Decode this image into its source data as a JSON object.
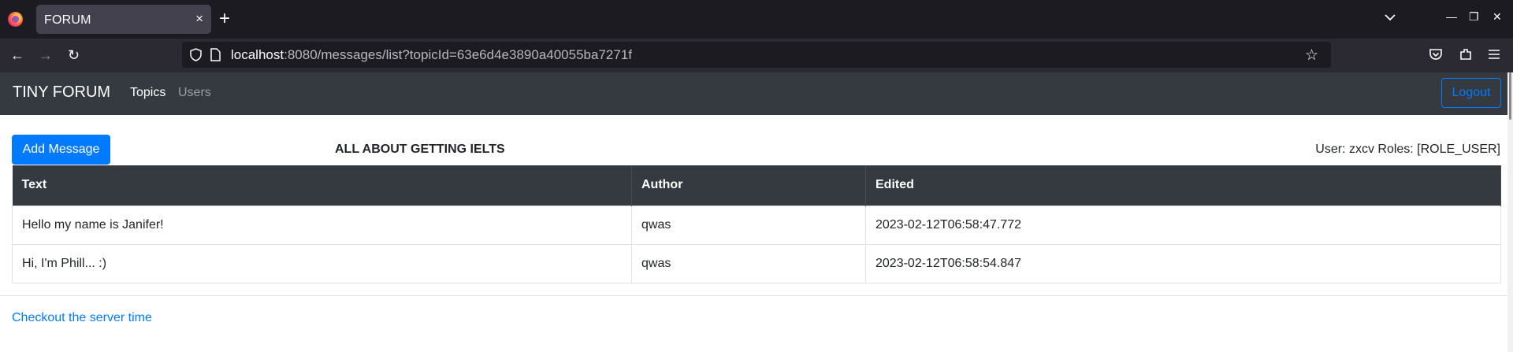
{
  "browser": {
    "tab_title": "FORUM",
    "tab_close": "×",
    "new_tab": "+",
    "url_host": "localhost",
    "url_rest": ":8080/messages/list?topicId=63e6d4e3890a40055ba7271f",
    "window_minimize": "—",
    "window_restore": "❐",
    "window_close": "✕",
    "back": "←",
    "forward": "→",
    "reload": "↻",
    "bookmark_star": "☆"
  },
  "site": {
    "brand": "TINY FORUM",
    "nav": {
      "topics": "Topics",
      "users": "Users"
    },
    "logout": "Logout"
  },
  "page": {
    "add_message": "Add Message",
    "topic_title": "ALL ABOUT GETTING IELTS",
    "user_info": "User: zxcv Roles: [ROLE_USER]",
    "table": {
      "headers": [
        "Text",
        "Author",
        "Edited"
      ],
      "rows": [
        {
          "text": "Hello my name is Janifer!",
          "author": "qwas",
          "edited": "2023-02-12T06:58:47.772"
        },
        {
          "text": "Hi, I'm Phill... :)",
          "author": "qwas",
          "edited": "2023-02-12T06:58:54.847"
        }
      ]
    },
    "server_time_link": "Checkout the server time"
  },
  "colors": {
    "primary": "#007bff",
    "navbar_dark": "#343a40",
    "browser_tabbar": "#1c1b22",
    "browser_toolbar": "#2b2a33"
  }
}
